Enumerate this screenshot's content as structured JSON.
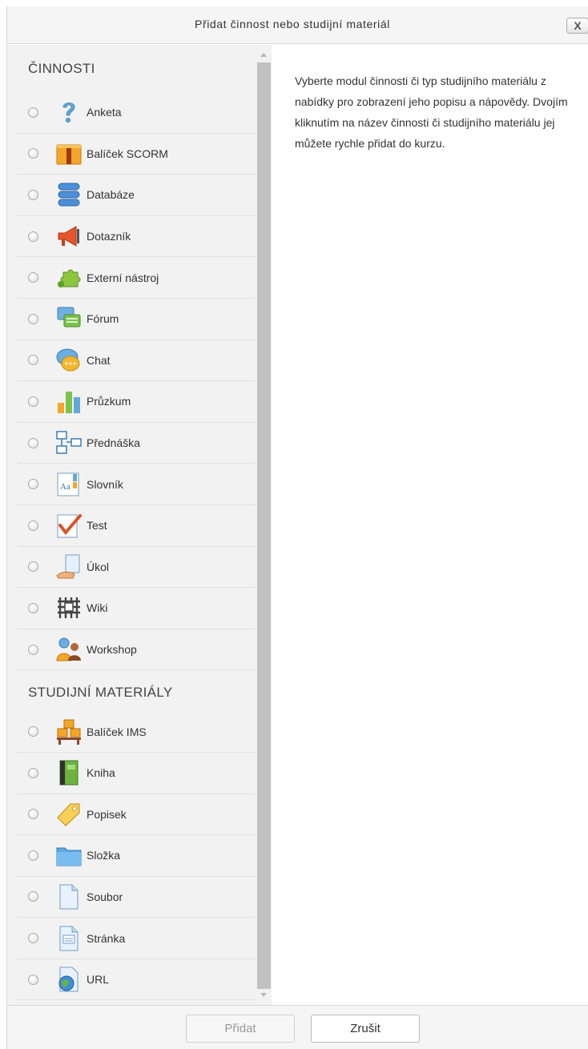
{
  "dialog": {
    "title": "Přidat činnost nebo studijní materiál",
    "close_label": "X"
  },
  "sections": [
    {
      "title": "ČINNOSTI",
      "items": [
        {
          "label": "Anketa",
          "icon": "question-icon"
        },
        {
          "label": "Balíček SCORM",
          "icon": "scorm-package-icon"
        },
        {
          "label": "Databáze",
          "icon": "database-icon"
        },
        {
          "label": "Dotazník",
          "icon": "megaphone-icon"
        },
        {
          "label": "Externí nástroj",
          "icon": "puzzle-icon"
        },
        {
          "label": "Fórum",
          "icon": "forum-icon"
        },
        {
          "label": "Chat",
          "icon": "chat-icon"
        },
        {
          "label": "Průzkum",
          "icon": "bar-chart-icon"
        },
        {
          "label": "Přednáška",
          "icon": "flowchart-icon"
        },
        {
          "label": "Slovník",
          "icon": "dictionary-icon"
        },
        {
          "label": "Test",
          "icon": "checkmark-icon"
        },
        {
          "label": "Úkol",
          "icon": "assignment-icon"
        },
        {
          "label": "Wiki",
          "icon": "wiki-icon"
        },
        {
          "label": "Workshop",
          "icon": "people-icon"
        }
      ]
    },
    {
      "title": "STUDIJNÍ MATERIÁLY",
      "items": [
        {
          "label": "Balíček IMS",
          "icon": "ims-boxes-icon"
        },
        {
          "label": "Kniha",
          "icon": "book-icon"
        },
        {
          "label": "Popisek",
          "icon": "label-tag-icon"
        },
        {
          "label": "Složka",
          "icon": "folder-icon"
        },
        {
          "label": "Soubor",
          "icon": "file-icon"
        },
        {
          "label": "Stránka",
          "icon": "page-icon"
        },
        {
          "label": "URL",
          "icon": "globe-icon"
        }
      ]
    }
  ],
  "help_text": "Vyberte modul činnosti či typ studijního materiálu z nabídky pro zobrazení jeho popisu a nápovědy. Dvojím kliknutím na název činnosti či studijního materiálu jej můžete rychle přidat do kurzu.",
  "buttons": {
    "add": "Přidat",
    "cancel": "Zrušit"
  },
  "colors": {
    "panel_bg": "#f2f2f2",
    "header_bg": "#f5f5f5",
    "scroll_thumb": "#c1c1c1"
  }
}
